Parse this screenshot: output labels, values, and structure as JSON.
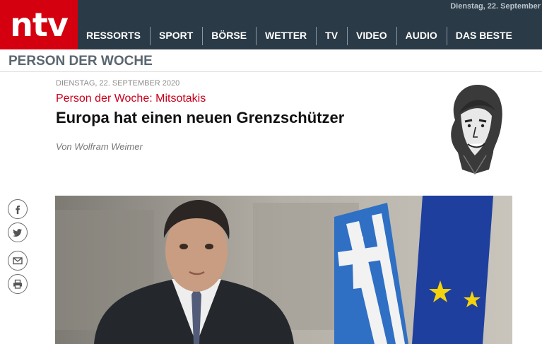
{
  "header": {
    "logo_text": "ntv",
    "date": "Dienstag, 22. September",
    "nav": [
      "RESSORTS",
      "SPORT",
      "BÖRSE",
      "WETTER",
      "TV",
      "VIDEO",
      "AUDIO",
      "DAS BESTE"
    ]
  },
  "section": {
    "title": "PERSON DER WOCHE"
  },
  "article": {
    "dateline": "DIENSTAG, 22. SEPTEMBER 2020",
    "kicker": "Person der Woche: Mitsotakis",
    "headline": "Europa hat einen neuen Grenzschützer",
    "author": "Von Wolfram Weimer"
  },
  "social": [
    "facebook-icon",
    "twitter-icon",
    "mail-icon",
    "print-icon"
  ],
  "colors": {
    "brand_red": "#d4000f",
    "nav_bg": "#2b3a47",
    "kicker_red": "#c8001b"
  }
}
